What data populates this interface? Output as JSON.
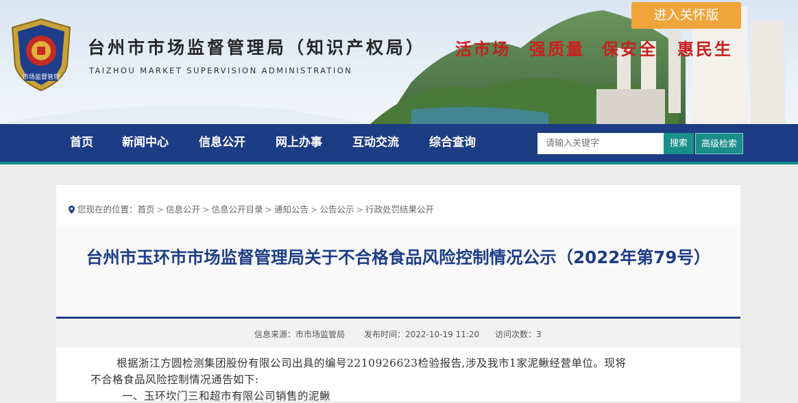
{
  "header": {
    "title": "台州市市场监督管理局（知识产权局）",
    "subtitle": "TAIZHOU MARKET SUPERVISION ADMINISTRATION",
    "emblem_text": "市场监督管理",
    "slogans": [
      "活市场",
      "强质量",
      "保安全",
      "惠民生"
    ],
    "care_button": "进入关怀版"
  },
  "nav": {
    "items": [
      "首页",
      "新闻中心",
      "信息公开",
      "网上办事",
      "互动交流",
      "综合查询"
    ],
    "search_placeholder": "请输入关键字",
    "search_button": "搜索",
    "advanced_button": "高级检索"
  },
  "breadcrumb": {
    "prefix": "您现在的位置：",
    "items": [
      "首页",
      "信息公开",
      "信息公开目录",
      "通知公告",
      "公告公示",
      "行政处罚结果公开"
    ],
    "separator": ">"
  },
  "article": {
    "title": "台州市玉环市市场监督管理局关于不合格食品风险控制情况公示（2022年第79号）",
    "meta": {
      "source_label": "信息来源：",
      "source": "市市场监管局",
      "time_label": "发布时间：",
      "time": "2022-10-19 11:20",
      "views_label": "访问次数：",
      "views": "3"
    },
    "paragraphs": [
      "根据浙江方圆检测集团股份有限公司出具的编号2210926623检验报告,涉及我市1家泥鳅经营单位。现将",
      "不合格食品风险控制情况通告如下:",
      "一、玉环坎门三和超市有限公司销售的泥鳅"
    ]
  },
  "colors": {
    "nav_bg": "#1c3c84",
    "accent_teal": "#1a8e88",
    "title_blue": "#1d3c85",
    "slogan_red": "#c8201e",
    "care_orange": "#f0a53a"
  }
}
